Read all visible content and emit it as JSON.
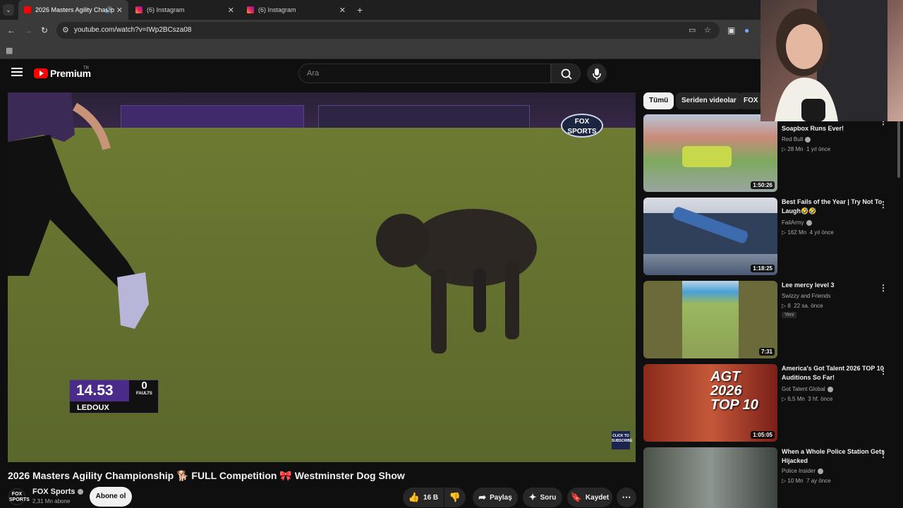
{
  "browser": {
    "tabs": [
      {
        "title": "2026 Masters Agility Champ",
        "active": true,
        "audio_icon": "speaker-icon"
      },
      {
        "title": "(6) Instagram",
        "active": false
      },
      {
        "title": "(6) Instagram",
        "active": false
      }
    ],
    "url": "youtube.com/watch?v=IWp2BCsza08"
  },
  "youtube": {
    "brand": "Premium",
    "region": "TR",
    "search_placeholder": "Ara"
  },
  "player": {
    "score_time": "14.53",
    "faults_value": "0",
    "faults_label": "FAULTS",
    "competitor": "LEDOUX",
    "network_badge": "FOX SPORTS",
    "subscribe_overlay": "CLICK TO SUBSCRIBE"
  },
  "video": {
    "title": "2026 Masters Agility Championship 🐕 FULL Competition 🎀 Westminster Dog Show",
    "channel": "FOX Sports",
    "channel_logo": "FOX SPORTS",
    "subscribers": "2,31 Mn abone",
    "subscribe_label": "Abone ol",
    "likes": "16 B",
    "share_label": "Paylaş",
    "ask_label": "Soru",
    "save_label": "Kaydet"
  },
  "chips": [
    "Tümü",
    "Seriden videolar",
    "FOX S"
  ],
  "recommendations": [
    {
      "title": "Soapbox Runs Ever!",
      "channel": "Red Bull",
      "views": "28 Mn",
      "age": "1 yıl önce",
      "duration": "1:50:26",
      "verified": true,
      "new": ""
    },
    {
      "title": "Best Fails of the Year | Try Not To Laugh🤣🤣",
      "channel": "FailArmy",
      "views": "162 Mn",
      "age": "4 yıl önce",
      "duration": "1:18:25",
      "verified": true,
      "new": ""
    },
    {
      "title": "Lee mercy level 3",
      "channel": "Swizzy and Friends",
      "views": "8",
      "age": "22 sa. önce",
      "duration": "7:31",
      "verified": false,
      "new": "Yeni"
    },
    {
      "title": "America's Got Talent 2026 TOP 10 Auditions So Far!",
      "channel": "Got Talent Global",
      "views": "6,5 Mn",
      "age": "3 hf. önce",
      "duration": "1:05:05",
      "verified": true,
      "new": "",
      "thumb_text": "AGT 2026 TOP 10"
    },
    {
      "title": "When a Whole Police Station Gets Hijacked",
      "channel": "Police Insider",
      "views": "10 Mn",
      "age": "7 ay önce",
      "duration": "",
      "verified": true,
      "new": ""
    }
  ],
  "colors": {
    "accent": "#ff0000",
    "score_purple": "#4b2b8a",
    "background": "#0f0f0f"
  }
}
